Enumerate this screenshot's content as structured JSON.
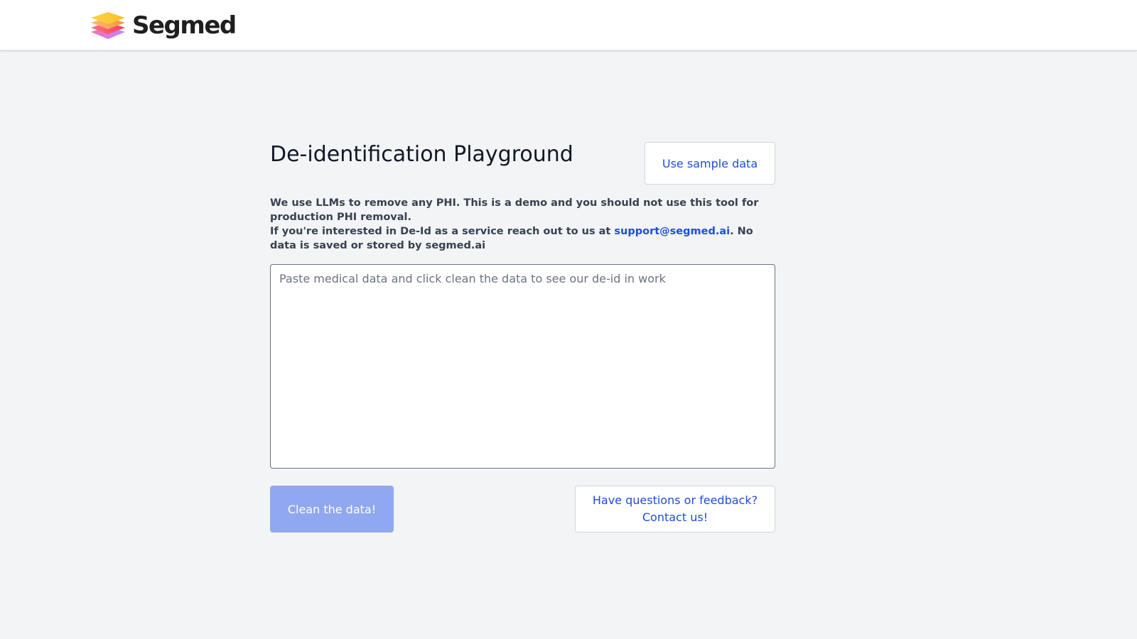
{
  "header": {
    "brand_name": "Segmed",
    "logo_icon": "stacked-layers-logo",
    "logo_colors": [
      "#fcd34d",
      "#fb923c",
      "#f43f5e",
      "#ec4899",
      "#c084fc"
    ]
  },
  "main": {
    "title": "De-identification Playground",
    "sample_button_label": "Use sample data",
    "notice": {
      "line1": "We use LLMs to remove any PHI. This is a demo and you should not use this tool for production PHI removal.",
      "line2_prefix": "If you're interested in De-Id as a service reach out to us at ",
      "email": "support@segmed.ai",
      "line2_suffix": ". No data is saved or stored by segmed.ai"
    },
    "input": {
      "placeholder": "Paste medical data and click clean the data to see our de-id in work",
      "value": ""
    },
    "clean_button_label": "Clean the data!",
    "contact_button": {
      "line1": "Have questions or feedback?",
      "line2": "Contact us!"
    }
  },
  "colors": {
    "page_background": "#f3f4f6",
    "link": "#1d4ed8",
    "primary_button_disabled": "#8fa8ef"
  }
}
